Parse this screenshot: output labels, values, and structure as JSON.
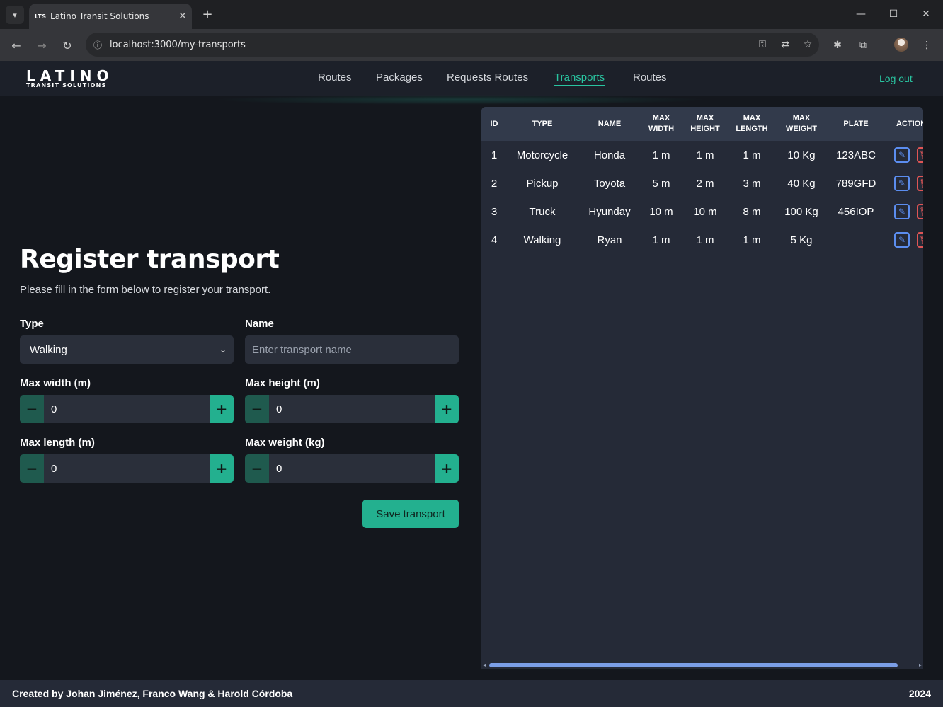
{
  "browser": {
    "tab_title": "Latino Transit Solutions",
    "tab_favicon": "LTS",
    "url": "localhost:3000/my-transports"
  },
  "header": {
    "logo_main": "LATINO",
    "logo_sub": "TRANSIT SOLUTIONS",
    "nav": [
      {
        "label": "Routes",
        "active": false
      },
      {
        "label": "Packages",
        "active": false
      },
      {
        "label": "Requests Routes",
        "active": false
      },
      {
        "label": "Transports",
        "active": true
      },
      {
        "label": "Routes",
        "active": false
      }
    ],
    "logout_label": "Log out"
  },
  "form": {
    "title": "Register transport",
    "subtitle": "Please fill in the form below to register your transport.",
    "type_label": "Type",
    "type_value": "Walking",
    "name_label": "Name",
    "name_placeholder": "Enter transport name",
    "max_width_label": "Max width (m)",
    "max_width_value": "0",
    "max_height_label": "Max height (m)",
    "max_height_value": "0",
    "max_length_label": "Max length (m)",
    "max_length_value": "0",
    "max_weight_label": "Max weight (kg)",
    "max_weight_value": "0",
    "save_label": "Save transport"
  },
  "table": {
    "headers": [
      "ID",
      "TYPE",
      "NAME",
      "MAX WIDTH",
      "MAX HEIGHT",
      "MAX LENGTH",
      "MAX WEIGHT",
      "PLATE",
      "ACTIONS"
    ],
    "rows": [
      {
        "id": "1",
        "type": "Motorcycle",
        "name": "Honda",
        "width": "1 m",
        "height": "1 m",
        "length": "1 m",
        "weight": "10 Kg",
        "plate": "123ABC"
      },
      {
        "id": "2",
        "type": "Pickup",
        "name": "Toyota",
        "width": "5 m",
        "height": "2 m",
        "length": "3 m",
        "weight": "40 Kg",
        "plate": "789GFD"
      },
      {
        "id": "3",
        "type": "Truck",
        "name": "Hyunday",
        "width": "10 m",
        "height": "10 m",
        "length": "8 m",
        "weight": "100 Kg",
        "plate": "456IOP"
      },
      {
        "id": "4",
        "type": "Walking",
        "name": "Ryan",
        "width": "1 m",
        "height": "1 m",
        "length": "1 m",
        "weight": "5 Kg",
        "plate": ""
      }
    ]
  },
  "footer": {
    "credits": "Created by Johan Jiménez, Franco Wang & Harold Córdoba",
    "year": "2024"
  },
  "colors": {
    "accent": "#23b08f",
    "background": "#14171d",
    "panel": "#252a37",
    "edit": "#5b8def",
    "delete": "#e05555"
  }
}
